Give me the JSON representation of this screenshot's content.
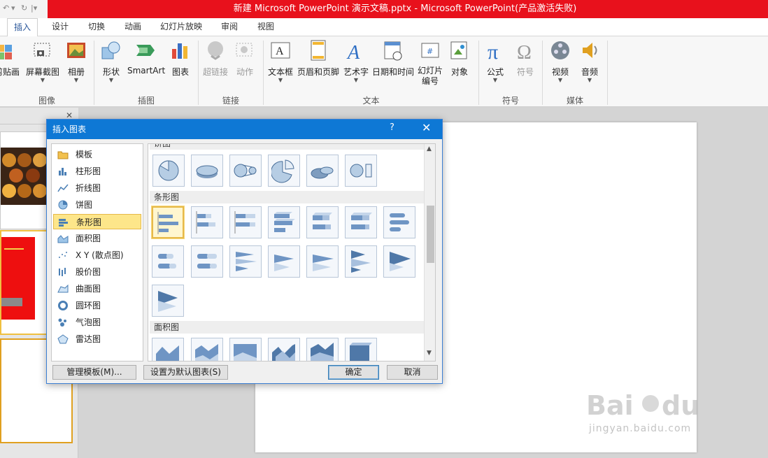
{
  "window": {
    "title": "新建 Microsoft PowerPoint 演示文稿.pptx - Microsoft PowerPoint(产品激活失败)"
  },
  "tabs": [
    {
      "label": "插入",
      "active": true
    },
    {
      "label": "设计"
    },
    {
      "label": "切换"
    },
    {
      "label": "动画"
    },
    {
      "label": "幻灯片放映"
    },
    {
      "label": "审阅"
    },
    {
      "label": "视图"
    }
  ],
  "ribbon": {
    "buttons": {
      "clipart": "剪贴画",
      "screenshot": "屏幕截图",
      "album": "相册",
      "shapes": "形状",
      "smartart": "SmartArt",
      "chart": "图表",
      "hyperlink": "超链接",
      "action": "动作",
      "textbox": "文本框",
      "header_footer": "页眉和页脚",
      "wordart": "艺术字",
      "datetime": "日期和时间",
      "slide_number": "幻灯片\n编号",
      "object": "对象",
      "equation": "公式",
      "symbol": "符号",
      "video": "视频",
      "audio": "音频"
    },
    "groups": {
      "images": "图像",
      "illustrations": "插图",
      "links": "链接",
      "text": "文本",
      "symbols": "符号",
      "media": "媒体"
    }
  },
  "dialog": {
    "title": "插入图表",
    "help": "?",
    "categories": [
      {
        "label": "模板"
      },
      {
        "label": "柱形图"
      },
      {
        "label": "折线图"
      },
      {
        "label": "饼图"
      },
      {
        "label": "条形图",
        "selected": true
      },
      {
        "label": "面积图"
      },
      {
        "label": "X Y (散点图)"
      },
      {
        "label": "股价图"
      },
      {
        "label": "曲面图"
      },
      {
        "label": "圆环图"
      },
      {
        "label": "气泡图"
      },
      {
        "label": "雷达图"
      }
    ],
    "sections": {
      "pie_partial": "饼图",
      "bar": "条形图",
      "area": "面积图"
    },
    "buttons": {
      "manage_templates": "管理模板(M)...",
      "set_default": "设置为默认图表(S)",
      "ok": "确定",
      "cancel": "取消"
    }
  },
  "watermark": {
    "url": "jingyan.baidu.com"
  },
  "colors": {
    "title_bar": "#e8111c",
    "dialog_title": "#0e78d5",
    "selected_category": "#fde68a",
    "ribbon_bg": "#f7f7f7"
  }
}
